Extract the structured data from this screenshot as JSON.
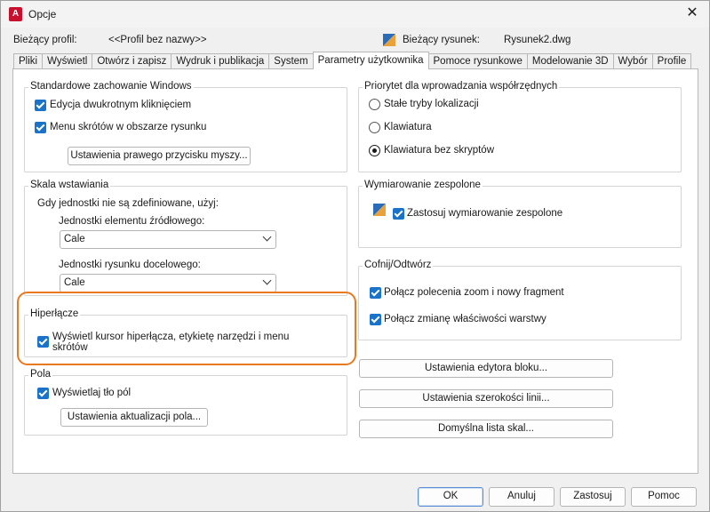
{
  "window": {
    "title": "Opcje",
    "app_icon_letter": "A",
    "close_glyph": "✕"
  },
  "profile": {
    "current_profile_label": "Bieżący profil:",
    "current_profile_value": "<<Profil bez nazwy>>",
    "current_drawing_label": "Bieżący rysunek:",
    "current_drawing_value": "Rysunek2.dwg"
  },
  "tabs": [
    {
      "label": "Pliki"
    },
    {
      "label": "Wyświetl"
    },
    {
      "label": "Otwórz i zapisz"
    },
    {
      "label": "Wydruk i publikacja"
    },
    {
      "label": "System"
    },
    {
      "label": "Parametry użytkownika"
    },
    {
      "label": "Pomoce rysunkowe"
    },
    {
      "label": "Modelowanie 3D"
    },
    {
      "label": "Wybór"
    },
    {
      "label": "Profile"
    }
  ],
  "windows_behavior": {
    "title": "Standardowe zachowanie Windows",
    "double_click_edit": "Edycja dwukrotnym kliknięciem",
    "shortcut_menus": "Menu skrótów w obszarze rysunku",
    "right_click_button": "Ustawienia prawego przycisku myszy..."
  },
  "insertion_scale": {
    "title": "Skala wstawiania",
    "subtitle": "Gdy jednostki nie są zdefiniowane, użyj:",
    "source_label": "Jednostki elementu źródłowego:",
    "source_value": "Cale",
    "target_label": "Jednostki rysunku docelowego:",
    "target_value": "Cale"
  },
  "hyperlink": {
    "title": "Hiperłącze",
    "option_line1": "Wyświetl kursor hiperłącza, etykietę narzędzi i menu",
    "option_line2": "skrótów"
  },
  "fields": {
    "title": "Pola",
    "display_background": "Wyświetlaj tło pól",
    "update_button": "Ustawienia aktualizacji pola..."
  },
  "coord_priority": {
    "title": "Priorytet dla wprowadzania współrzędnych",
    "option_running": "Stałe tryby lokalizacji",
    "option_keyboard": "Klawiatura",
    "option_keyboard_no_scripts": "Klawiatura bez skryptów"
  },
  "assoc_dim": {
    "title": "Wymiarowanie zespolone",
    "option": "Zastosuj wymiarowanie zespolone"
  },
  "undo_redo": {
    "title": "Cofnij/Odtwórz",
    "combine_zoom": "Połącz polecenia zoom i nowy fragment",
    "combine_layer": "Połącz zmianę właściwości warstwy"
  },
  "side_buttons": {
    "block_editor": "Ustawienia edytora bloku...",
    "line_weight": "Ustawienia szerokości linii...",
    "default_scale_list": "Domyślna lista skal..."
  },
  "footer": {
    "ok": "OK",
    "cancel": "Anuluj",
    "apply": "Zastosuj",
    "help": "Pomoc"
  },
  "colors": {
    "accent_blue": "#1a73c8",
    "highlight_orange": "#e8791f",
    "app_red": "#c8102e"
  }
}
